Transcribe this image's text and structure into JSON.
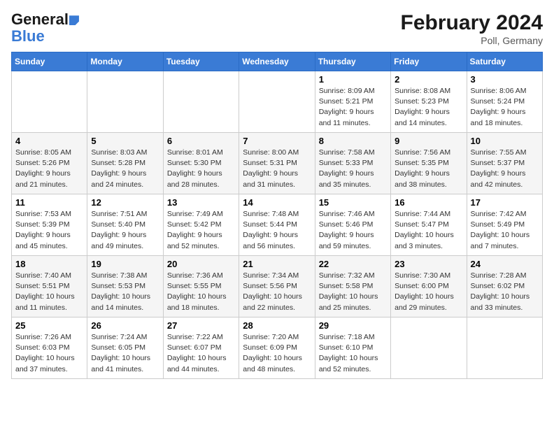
{
  "header": {
    "logo_line1": "General",
    "logo_line2": "Blue",
    "month_year": "February 2024",
    "location": "Poll, Germany"
  },
  "weekdays": [
    "Sunday",
    "Monday",
    "Tuesday",
    "Wednesday",
    "Thursday",
    "Friday",
    "Saturday"
  ],
  "weeks": [
    [
      {
        "day": "",
        "info": ""
      },
      {
        "day": "",
        "info": ""
      },
      {
        "day": "",
        "info": ""
      },
      {
        "day": "",
        "info": ""
      },
      {
        "day": "1",
        "info": "Sunrise: 8:09 AM\nSunset: 5:21 PM\nDaylight: 9 hours\nand 11 minutes."
      },
      {
        "day": "2",
        "info": "Sunrise: 8:08 AM\nSunset: 5:23 PM\nDaylight: 9 hours\nand 14 minutes."
      },
      {
        "day": "3",
        "info": "Sunrise: 8:06 AM\nSunset: 5:24 PM\nDaylight: 9 hours\nand 18 minutes."
      }
    ],
    [
      {
        "day": "4",
        "info": "Sunrise: 8:05 AM\nSunset: 5:26 PM\nDaylight: 9 hours\nand 21 minutes."
      },
      {
        "day": "5",
        "info": "Sunrise: 8:03 AM\nSunset: 5:28 PM\nDaylight: 9 hours\nand 24 minutes."
      },
      {
        "day": "6",
        "info": "Sunrise: 8:01 AM\nSunset: 5:30 PM\nDaylight: 9 hours\nand 28 minutes."
      },
      {
        "day": "7",
        "info": "Sunrise: 8:00 AM\nSunset: 5:31 PM\nDaylight: 9 hours\nand 31 minutes."
      },
      {
        "day": "8",
        "info": "Sunrise: 7:58 AM\nSunset: 5:33 PM\nDaylight: 9 hours\nand 35 minutes."
      },
      {
        "day": "9",
        "info": "Sunrise: 7:56 AM\nSunset: 5:35 PM\nDaylight: 9 hours\nand 38 minutes."
      },
      {
        "day": "10",
        "info": "Sunrise: 7:55 AM\nSunset: 5:37 PM\nDaylight: 9 hours\nand 42 minutes."
      }
    ],
    [
      {
        "day": "11",
        "info": "Sunrise: 7:53 AM\nSunset: 5:39 PM\nDaylight: 9 hours\nand 45 minutes."
      },
      {
        "day": "12",
        "info": "Sunrise: 7:51 AM\nSunset: 5:40 PM\nDaylight: 9 hours\nand 49 minutes."
      },
      {
        "day": "13",
        "info": "Sunrise: 7:49 AM\nSunset: 5:42 PM\nDaylight: 9 hours\nand 52 minutes."
      },
      {
        "day": "14",
        "info": "Sunrise: 7:48 AM\nSunset: 5:44 PM\nDaylight: 9 hours\nand 56 minutes."
      },
      {
        "day": "15",
        "info": "Sunrise: 7:46 AM\nSunset: 5:46 PM\nDaylight: 9 hours\nand 59 minutes."
      },
      {
        "day": "16",
        "info": "Sunrise: 7:44 AM\nSunset: 5:47 PM\nDaylight: 10 hours\nand 3 minutes."
      },
      {
        "day": "17",
        "info": "Sunrise: 7:42 AM\nSunset: 5:49 PM\nDaylight: 10 hours\nand 7 minutes."
      }
    ],
    [
      {
        "day": "18",
        "info": "Sunrise: 7:40 AM\nSunset: 5:51 PM\nDaylight: 10 hours\nand 11 minutes."
      },
      {
        "day": "19",
        "info": "Sunrise: 7:38 AM\nSunset: 5:53 PM\nDaylight: 10 hours\nand 14 minutes."
      },
      {
        "day": "20",
        "info": "Sunrise: 7:36 AM\nSunset: 5:55 PM\nDaylight: 10 hours\nand 18 minutes."
      },
      {
        "day": "21",
        "info": "Sunrise: 7:34 AM\nSunset: 5:56 PM\nDaylight: 10 hours\nand 22 minutes."
      },
      {
        "day": "22",
        "info": "Sunrise: 7:32 AM\nSunset: 5:58 PM\nDaylight: 10 hours\nand 25 minutes."
      },
      {
        "day": "23",
        "info": "Sunrise: 7:30 AM\nSunset: 6:00 PM\nDaylight: 10 hours\nand 29 minutes."
      },
      {
        "day": "24",
        "info": "Sunrise: 7:28 AM\nSunset: 6:02 PM\nDaylight: 10 hours\nand 33 minutes."
      }
    ],
    [
      {
        "day": "25",
        "info": "Sunrise: 7:26 AM\nSunset: 6:03 PM\nDaylight: 10 hours\nand 37 minutes."
      },
      {
        "day": "26",
        "info": "Sunrise: 7:24 AM\nSunset: 6:05 PM\nDaylight: 10 hours\nand 41 minutes."
      },
      {
        "day": "27",
        "info": "Sunrise: 7:22 AM\nSunset: 6:07 PM\nDaylight: 10 hours\nand 44 minutes."
      },
      {
        "day": "28",
        "info": "Sunrise: 7:20 AM\nSunset: 6:09 PM\nDaylight: 10 hours\nand 48 minutes."
      },
      {
        "day": "29",
        "info": "Sunrise: 7:18 AM\nSunset: 6:10 PM\nDaylight: 10 hours\nand 52 minutes."
      },
      {
        "day": "",
        "info": ""
      },
      {
        "day": "",
        "info": ""
      }
    ]
  ]
}
